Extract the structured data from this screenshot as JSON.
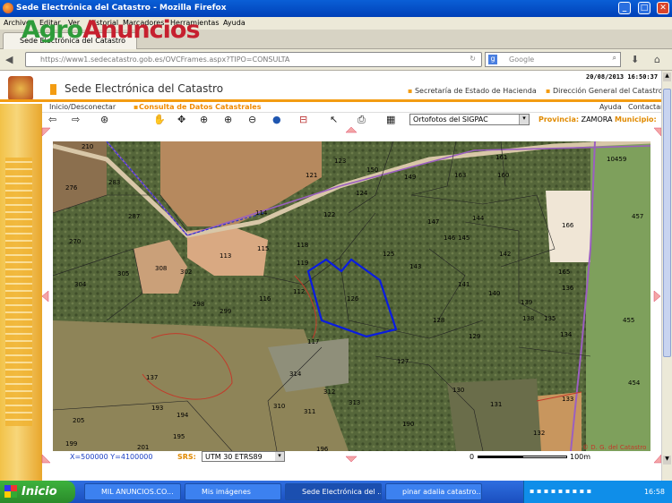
{
  "window": {
    "title": "Sede Electrónica del Catastro - Mozilla Firefox",
    "buttons": [
      "_",
      "□",
      "✕"
    ]
  },
  "menu": [
    "Archivo",
    "Editar",
    "Ver",
    "Historial",
    "Marcadores",
    "Herramientas",
    "Ayuda"
  ],
  "tab": {
    "title": "Sede Electrónica del Catastro"
  },
  "watermark": {
    "agro": "Agro",
    "anuncios": "Anuncios"
  },
  "nav": {
    "url": "https://www1.sedecatastro.gob.es/OVCFrames.aspx?TIPO=CONSULTA",
    "search_placeholder": "Google"
  },
  "header": {
    "datetime": "20/08/2013 16:50:37",
    "site_title": "Sede Electrónica del Catastro",
    "link1": "Secretaría de Estado de Hacienda",
    "link2": "Dirección General del Catastro",
    "nav_home": "Inicio/Desconectar",
    "nav_consulta": "Consulta de Datos Catastrales",
    "ayuda": "Ayuda",
    "contactar": "Contactar"
  },
  "map_toolbar": {
    "layer_select": "Ortofotos del SIGPAC",
    "provincia_label": "Provincia:",
    "provincia_value": "ZAMORA",
    "municipio_label": "Municipio:"
  },
  "map_footer": {
    "coords": "X=500000 Y=4100000",
    "srs_label": "SRS:",
    "srs_value": "UTM 30 ETRS89",
    "scale_zero": "0",
    "scale_end": "100m",
    "copyright": "© D. G. del Catastro"
  },
  "parcels": [
    {
      "n": "276"
    },
    {
      "n": "210"
    },
    {
      "n": "283"
    },
    {
      "n": "287"
    },
    {
      "n": "270"
    },
    {
      "n": "305"
    },
    {
      "n": "304"
    },
    {
      "n": "308"
    },
    {
      "n": "302"
    },
    {
      "n": "298"
    },
    {
      "n": "299"
    },
    {
      "n": "113"
    },
    {
      "n": "114"
    },
    {
      "n": "115"
    },
    {
      "n": "116"
    },
    {
      "n": "118"
    },
    {
      "n": "119"
    },
    {
      "n": "112"
    },
    {
      "n": "121"
    },
    {
      "n": "122"
    },
    {
      "n": "123"
    },
    {
      "n": "124"
    },
    {
      "n": "125"
    },
    {
      "n": "126"
    },
    {
      "n": "117"
    },
    {
      "n": "137"
    },
    {
      "n": "150"
    },
    {
      "n": "149"
    },
    {
      "n": "163"
    },
    {
      "n": "161"
    },
    {
      "n": "166"
    },
    {
      "n": "145"
    },
    {
      "n": "144"
    },
    {
      "n": "147"
    },
    {
      "n": "143"
    },
    {
      "n": "142"
    },
    {
      "n": "141"
    },
    {
      "n": "140"
    },
    {
      "n": "139"
    },
    {
      "n": "138"
    },
    {
      "n": "135"
    },
    {
      "n": "134"
    },
    {
      "n": "128"
    },
    {
      "n": "129"
    },
    {
      "n": "127"
    },
    {
      "n": "130"
    },
    {
      "n": "131"
    },
    {
      "n": "132"
    },
    {
      "n": "133"
    },
    {
      "n": "136"
    },
    {
      "n": "165"
    },
    {
      "n": "10459"
    },
    {
      "n": "457"
    },
    {
      "n": "455"
    },
    {
      "n": "454"
    },
    {
      "n": "314"
    },
    {
      "n": "312"
    },
    {
      "n": "313"
    },
    {
      "n": "310"
    },
    {
      "n": "311"
    },
    {
      "n": "190"
    },
    {
      "n": "193"
    },
    {
      "n": "194"
    },
    {
      "n": "195"
    },
    {
      "n": "201"
    },
    {
      "n": "196"
    },
    {
      "n": "205"
    },
    {
      "n": "199"
    },
    {
      "n": "160"
    },
    {
      "n": "146"
    }
  ],
  "taskbar": {
    "start": "Inicio",
    "tasks": [
      "MIL ANUNCIOS.CO...",
      "Mis imágenes",
      "Sede Electrónica del ...",
      "pinar adalia catastro..."
    ],
    "clock": "16:58"
  }
}
